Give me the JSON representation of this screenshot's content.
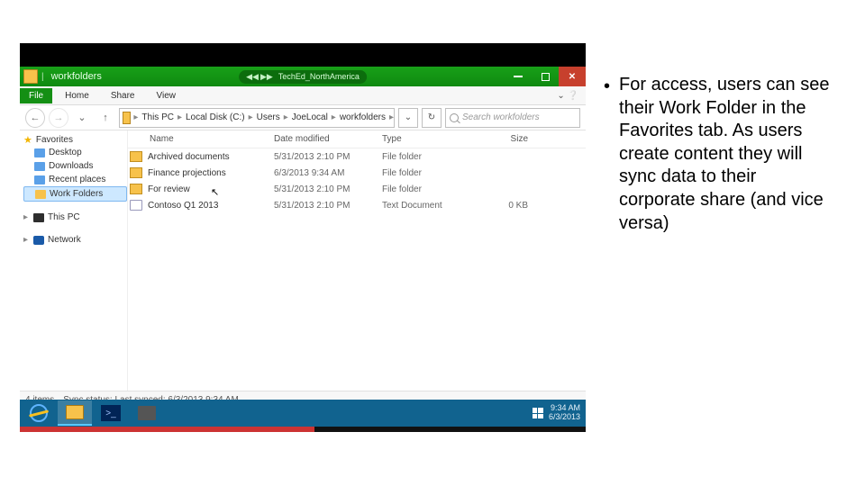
{
  "bullet": "For access, users can see their Work Folder in the Favorites tab. As users create content they will sync data to their corporate share (and vice versa)",
  "titlebar": {
    "folder_name": "workfolders",
    "media_title": "TechEd_NorthAmerica"
  },
  "ribbon": {
    "file": "File",
    "home": "Home",
    "share": "Share",
    "view": "View"
  },
  "breadcrumb": [
    "This PC",
    "Local Disk (C:)",
    "Users",
    "JoeLocal",
    "workfolders"
  ],
  "search_placeholder": "Search workfolders",
  "tree": {
    "favorites": "Favorites",
    "desktop": "Desktop",
    "downloads": "Downloads",
    "recent": "Recent places",
    "workfolders": "Work Folders",
    "thispc": "This PC",
    "network": "Network"
  },
  "columns": {
    "name": "Name",
    "date": "Date modified",
    "type": "Type",
    "size": "Size"
  },
  "files": [
    {
      "icon": "folder",
      "name": "Archived documents",
      "date": "5/31/2013 2:10 PM",
      "type": "File folder",
      "size": ""
    },
    {
      "icon": "folder",
      "name": "Finance projections",
      "date": "6/3/2013 9:34 AM",
      "type": "File folder",
      "size": ""
    },
    {
      "icon": "folder",
      "name": "For review",
      "date": "5/31/2013 2:10 PM",
      "type": "File folder",
      "size": ""
    },
    {
      "icon": "txt",
      "name": "Contoso Q1 2013",
      "date": "5/31/2013 2:10 PM",
      "type": "Text Document",
      "size": "0 KB"
    }
  ],
  "status": {
    "items": "4 items",
    "sync": "Sync status: Last synced: 6/3/2013 9:34 AM"
  },
  "clock": {
    "time": "9:34 AM",
    "date": "6/3/2013"
  }
}
